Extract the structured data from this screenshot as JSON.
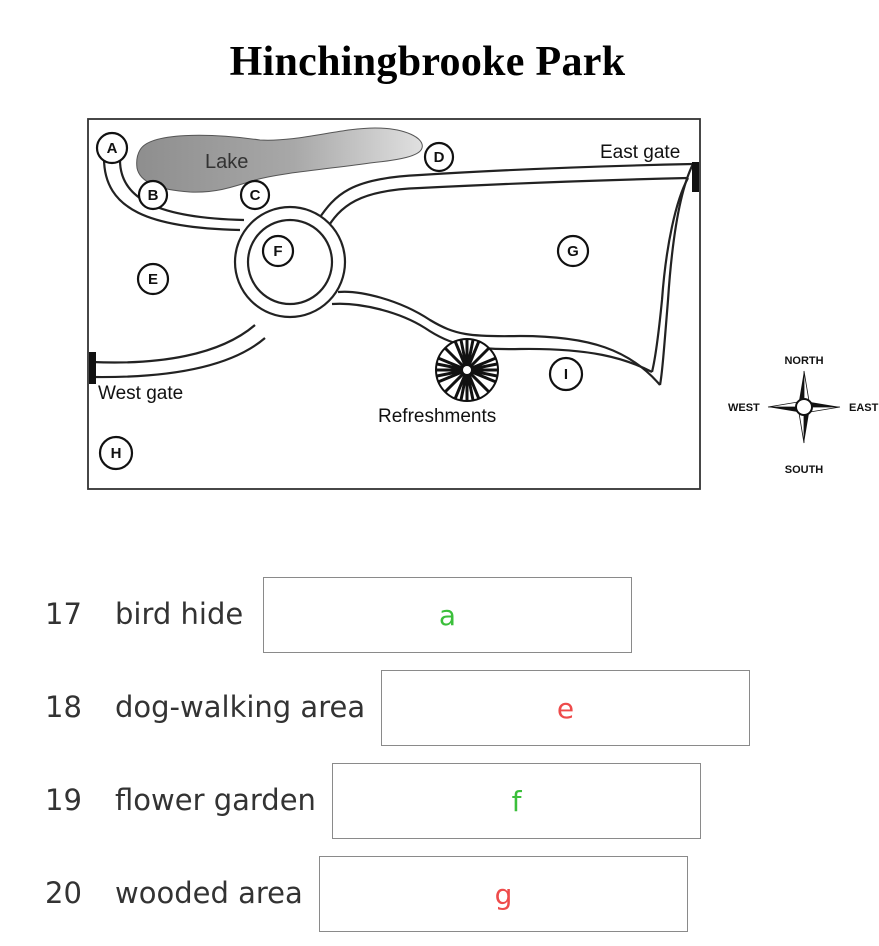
{
  "title": "Hinchingbrooke Park",
  "map": {
    "labels": {
      "lake": "Lake",
      "east_gate": "East gate",
      "west_gate": "West gate",
      "refreshments": "Refreshments"
    },
    "markers": [
      "A",
      "B",
      "C",
      "D",
      "E",
      "F",
      "G",
      "H",
      "I"
    ],
    "compass": {
      "north": "NORTH",
      "south": "SOUTH",
      "east": "EAST",
      "west": "WEST"
    }
  },
  "questions": [
    {
      "number": "17",
      "label": "bird hide",
      "answer": "a",
      "status": "correct",
      "color": "#3bbf3b"
    },
    {
      "number": "18",
      "label": "dog-walking area",
      "answer": "e",
      "status": "wrong",
      "color": "#ee4b4b"
    },
    {
      "number": "19",
      "label": "flower garden",
      "answer": "f",
      "status": "correct",
      "color": "#3bbf3b"
    },
    {
      "number": "20",
      "label": "wooded area",
      "answer": "g",
      "status": "wrong",
      "color": "#ee4b4b"
    }
  ]
}
